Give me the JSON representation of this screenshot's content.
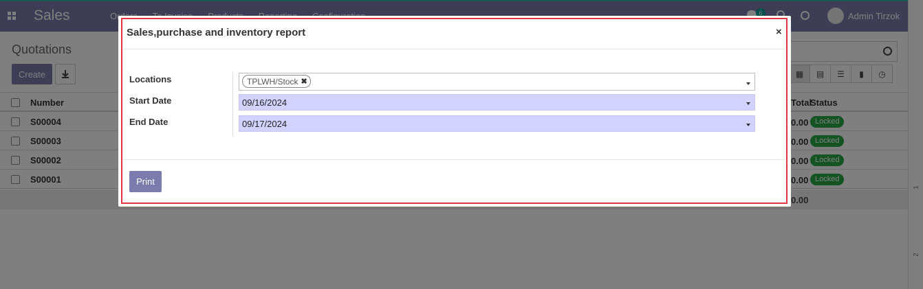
{
  "app": {
    "brand": "Sales",
    "user_name": "Admin Tirzok",
    "chat_count": "6"
  },
  "menu": [
    "Orders",
    "To Invoice",
    "Products",
    "Reporting",
    "Configuration"
  ],
  "control": {
    "breadcrumb": "Quotations",
    "create_label": "Create"
  },
  "list": {
    "headers": {
      "number": "Number",
      "total": "Total",
      "status": "Status"
    },
    "rows": [
      {
        "number": "S00004",
        "total": "0.00 ৳",
        "status": "Locked"
      },
      {
        "number": "S00003",
        "total": "0.00 ৳",
        "status": "Locked"
      },
      {
        "number": "S00002",
        "total": "0.00 ৳",
        "status": "Locked"
      },
      {
        "number": "S00001",
        "total": "0.00 ৳",
        "status": "Locked"
      }
    ],
    "footer_total": "0.00"
  },
  "modal": {
    "title": "Sales,purchase and inventory report",
    "close": "×",
    "locations_label": "Locations",
    "location_tag": "TPLWH/Stock",
    "start_label": "Start Date",
    "start_value": "09/16/2024",
    "end_label": "End Date",
    "end_value": "09/17/2024",
    "print_label": "Print"
  },
  "colors": {
    "brand": "#7c7bad",
    "date_field": "#d2d2ff",
    "highlight": "#e2353f",
    "status": "#28a745"
  }
}
